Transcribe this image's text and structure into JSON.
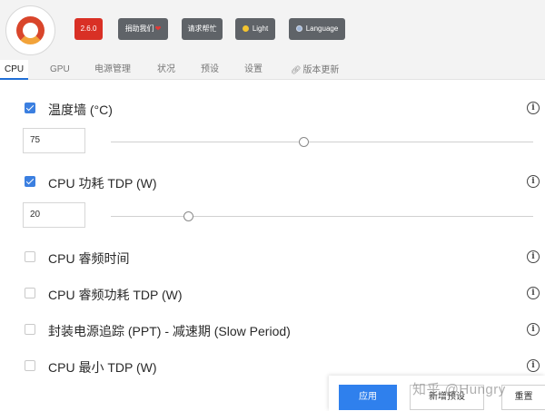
{
  "header": {
    "version_label": "2.6.0",
    "donate_label": "捐助我们",
    "donate_heart": "❤",
    "help_label": "请求帮忙",
    "theme_label": "Light",
    "language_label": "Language"
  },
  "tabs": [
    {
      "label": "CPU",
      "active": true
    },
    {
      "label": "GPU"
    },
    {
      "label": "电源管理"
    },
    {
      "label": "状况"
    },
    {
      "label": "预设"
    },
    {
      "label": "设置"
    },
    {
      "label": "版本更新",
      "icon": "link-icon"
    }
  ],
  "settings": {
    "temp_limit": {
      "label": "温度墙 (°C)",
      "checked": true,
      "value": "75",
      "slider_fraction": 0.5
    },
    "cpu_tdp": {
      "label": "CPU 功耗 TDP (W)",
      "checked": true,
      "value": "20",
      "slider_fraction": 0.18
    },
    "boost_time": {
      "label": "CPU 睿频时间",
      "checked": false
    },
    "boost_tdp": {
      "label": "CPU 睿频功耗 TDP (W)",
      "checked": false
    },
    "ppt_slow": {
      "label": "封装电源追踪 (PPT) - 减速期 (Slow Period)",
      "checked": false
    },
    "min_tdp": {
      "label": "CPU 最小 TDP (W)",
      "checked": false
    },
    "info_glyph": "i"
  },
  "footer": {
    "apply_label": "应用",
    "add_preset_label": "新增预设",
    "reset_label": "重置"
  },
  "watermark": "知乎 @Hungry",
  "colors": {
    "accent": "#2f80ed",
    "version_badge": "#d93025",
    "header_button": "#5f6368"
  }
}
